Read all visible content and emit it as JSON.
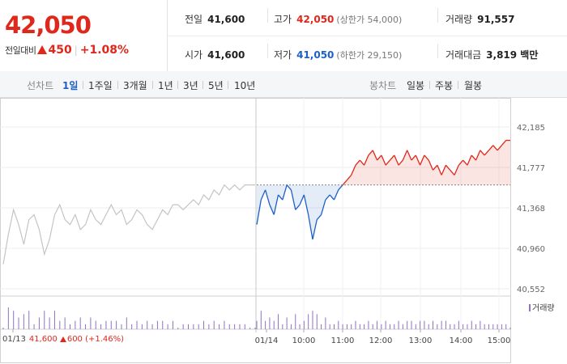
{
  "price": {
    "current": "42,050",
    "change_label": "전일대비",
    "change_amount": "450",
    "change_rate": "+1.08%"
  },
  "stats": {
    "prev_close_label": "전일",
    "prev_close": "41,600",
    "high_label": "고가",
    "high": "42,050",
    "upper_limit_label": "(상한가 54,000)",
    "volume_label": "거래량",
    "volume": "91,557",
    "open_label": "시가",
    "open": "41,600",
    "low_label": "저가",
    "low": "41,050",
    "lower_limit_label": "(하한가 29,150)",
    "trade_value_label": "거래대금",
    "trade_value": "3,819 백만"
  },
  "tabs": {
    "line_label": "선차트",
    "line_tabs": [
      "1일",
      "1주일",
      "3개월",
      "1년",
      "3년",
      "5년",
      "10년"
    ],
    "line_active": "1일",
    "candle_label": "봉차트",
    "candle_tabs": [
      "일봉",
      "주봉",
      "월봉"
    ]
  },
  "chart_data": {
    "type": "line",
    "y_ticks": [
      "42,185",
      "41,777",
      "41,368",
      "40,960",
      "40,552"
    ],
    "ylim": [
      40552,
      42185
    ],
    "x_ticks": [
      "01/13",
      "01/14",
      "10:00",
      "11:00",
      "12:00",
      "13:00",
      "14:00",
      "15:00"
    ],
    "reference_price": 41600,
    "previous_day": {
      "date": "01/13",
      "price": "41,600",
      "change": "600",
      "change_rate": "(+1.46%)",
      "values": [
        40800,
        41100,
        41350,
        41200,
        41000,
        41250,
        41300,
        41150,
        40900,
        41050,
        41300,
        41400,
        41250,
        41200,
        41300,
        41150,
        41200,
        41350,
        41250,
        41200,
        41300,
        41400,
        41300,
        41350,
        41200,
        41250,
        41350,
        41300,
        41200,
        41150,
        41250,
        41350,
        41300,
        41400,
        41400,
        41350,
        41400,
        41450,
        41400,
        41500,
        41450,
        41550,
        41500,
        41600,
        41550,
        41600,
        41550,
        41600,
        41600,
        41600
      ]
    },
    "today": {
      "values": [
        41200,
        41450,
        41550,
        41400,
        41300,
        41500,
        41450,
        41600,
        41550,
        41350,
        41400,
        41500,
        41300,
        41050,
        41250,
        41300,
        41450,
        41500,
        41450,
        41550,
        41600,
        41650,
        41700,
        41800,
        41850,
        41800,
        41900,
        41950,
        41850,
        41900,
        41800,
        41850,
        41900,
        41800,
        41850,
        41950,
        41850,
        41900,
        41800,
        41900,
        41850,
        41750,
        41800,
        41700,
        41800,
        41750,
        41700,
        41800,
        41850,
        41800,
        41900,
        41850,
        41950,
        41900,
        41950,
        42000,
        41950,
        42000,
        42050,
        42050
      ],
      "color_up": "#e0271b",
      "color_down": "#1d60c9"
    },
    "volume_legend": "거래량",
    "volume_color": "#8e72c7",
    "grid": true
  }
}
